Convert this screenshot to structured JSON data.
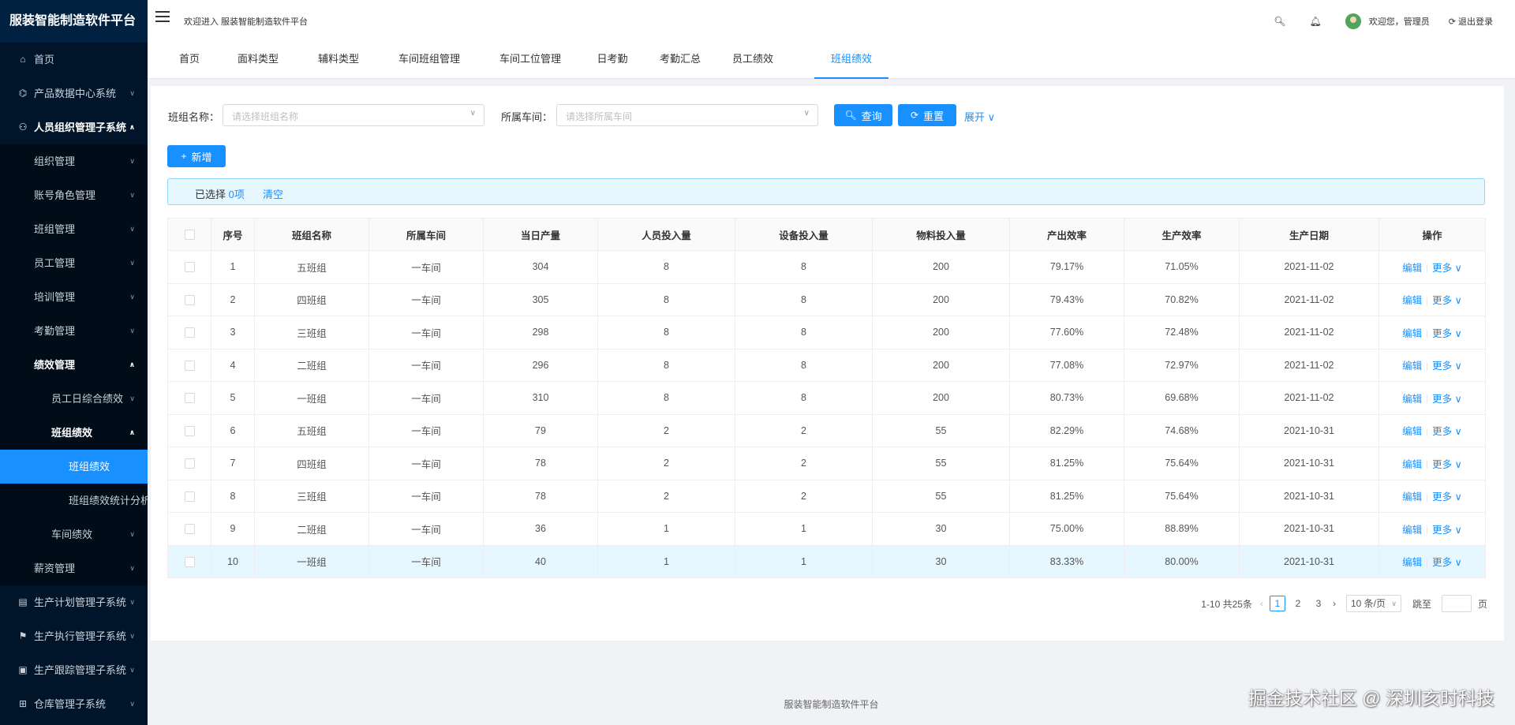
{
  "app": {
    "title": "服装智能制造软件平台"
  },
  "header": {
    "welcome": "欢迎进入 服装智能制造软件平台",
    "greeting": "欢迎您，管理员",
    "logout": "退出登录"
  },
  "sidebar": {
    "home": "首页",
    "product_data": "产品数据中心系统",
    "hr": "人员组织管理子系统",
    "hr_children": {
      "org": "组织管理",
      "account": "账号角色管理",
      "team": "班组管理",
      "staff": "员工管理",
      "training": "培训管理",
      "attendance": "考勤管理",
      "performance": "绩效管理",
      "perf_children": {
        "staff_daily": "员工日综合绩效",
        "team_perf": "班组绩效",
        "team_perf_children": {
          "team_perf_page": "班组绩效",
          "team_perf_stats": "班组绩效统计分析"
        },
        "workshop_perf": "车间绩效"
      },
      "salary": "薪资管理"
    },
    "plan": "生产计划管理子系统",
    "exec": "生产执行管理子系统",
    "track": "生产跟踪管理子系统",
    "warehouse": "仓库管理子系统"
  },
  "tabs": [
    "首页",
    "面料类型",
    "辅料类型",
    "车间班组管理",
    "车间工位管理",
    "日考勤",
    "考勤汇总",
    "员工绩效",
    "班组绩效"
  ],
  "search": {
    "team_label": "班组名称：",
    "team_placeholder": "请选择班组名称",
    "workshop_label": "所属车间：",
    "workshop_placeholder": "请选择所属车间",
    "query": "查询",
    "reset": "重置",
    "expand": "展开"
  },
  "toolbar": {
    "add": "新增"
  },
  "alert": {
    "prefix": "已选择",
    "count": "0项",
    "clear": "清空"
  },
  "table": {
    "headers": [
      "序号",
      "班组名称",
      "所属车间",
      "当日产量",
      "人员投入量",
      "设备投入量",
      "物料投入量",
      "产出效率",
      "生产效率",
      "生产日期",
      "操作"
    ],
    "edit": "编辑",
    "more": "更多",
    "rows": [
      [
        "1",
        "五班组",
        "一车间",
        "304",
        "8",
        "8",
        "200",
        "79.17%",
        "71.05%",
        "2021-11-02"
      ],
      [
        "2",
        "四班组",
        "一车间",
        "305",
        "8",
        "8",
        "200",
        "79.43%",
        "70.82%",
        "2021-11-02"
      ],
      [
        "3",
        "三班组",
        "一车间",
        "298",
        "8",
        "8",
        "200",
        "77.60%",
        "72.48%",
        "2021-11-02"
      ],
      [
        "4",
        "二班组",
        "一车间",
        "296",
        "8",
        "8",
        "200",
        "77.08%",
        "72.97%",
        "2021-11-02"
      ],
      [
        "5",
        "一班组",
        "一车间",
        "310",
        "8",
        "8",
        "200",
        "80.73%",
        "69.68%",
        "2021-11-02"
      ],
      [
        "6",
        "五班组",
        "一车间",
        "79",
        "2",
        "2",
        "55",
        "82.29%",
        "74.68%",
        "2021-10-31"
      ],
      [
        "7",
        "四班组",
        "一车间",
        "78",
        "2",
        "2",
        "55",
        "81.25%",
        "75.64%",
        "2021-10-31"
      ],
      [
        "8",
        "三班组",
        "一车间",
        "78",
        "2",
        "2",
        "55",
        "81.25%",
        "75.64%",
        "2021-10-31"
      ],
      [
        "9",
        "二班组",
        "一车间",
        "36",
        "1",
        "1",
        "30",
        "75.00%",
        "88.89%",
        "2021-10-31"
      ],
      [
        "10",
        "一班组",
        "一车间",
        "40",
        "1",
        "1",
        "30",
        "83.33%",
        "80.00%",
        "2021-10-31"
      ]
    ]
  },
  "pagination": {
    "total": "1-10 共25条",
    "pages": [
      "1",
      "2",
      "3"
    ],
    "current": "1",
    "page_size": "10 条/页",
    "jump_prefix": "跳至",
    "jump_suffix": "页"
  },
  "footer": {
    "text": "服装智能制造软件平台"
  },
  "watermark": "掘金技术社区 @ 深圳亥时科技",
  "colors": {
    "primary": "#1890ff",
    "sidebar_bg": "#001529",
    "highlight_row": "#e6f7ff"
  }
}
